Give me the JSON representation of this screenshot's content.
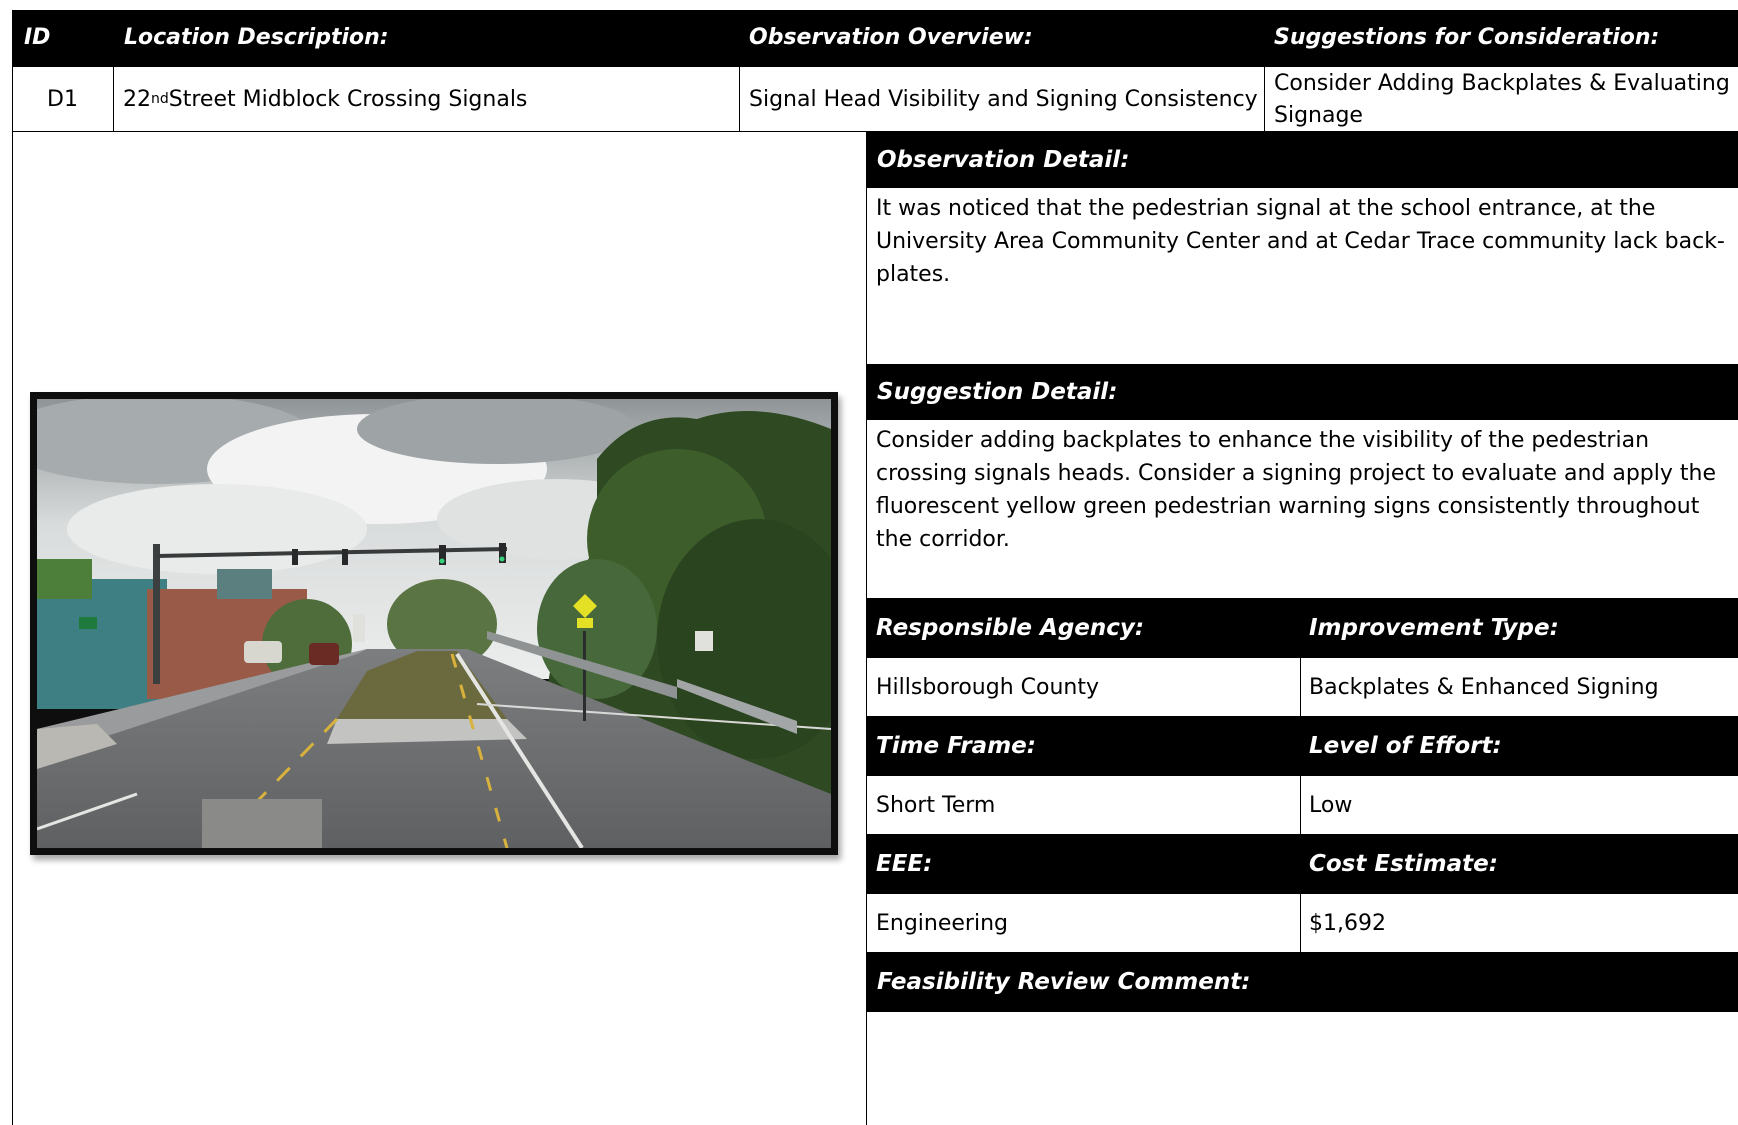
{
  "header": {
    "id": "ID",
    "location": "Location Description:",
    "observation": "Observation Overview:",
    "suggestions": "Suggestions for Consideration:"
  },
  "record": {
    "id": "D1",
    "location_number": "22",
    "location_sup": "nd",
    "location_rest": " Street Midblock Crossing Signals",
    "observation": "Signal Head Visibility and Signing Consistency",
    "suggestion": "Consider Adding Backplates & Evaluating Signage"
  },
  "observation_detail": {
    "label": "Observation Detail:",
    "text": "It was noticed that the pedestrian signal at the school entrance, at the University Area Community Center and at Cedar Trace community lack back-plates."
  },
  "suggestion_detail": {
    "label": "Suggestion Detail:",
    "text": "Consider adding backplates to enhance the visibility of the pedestrian crossing signals heads. Consider a signing project to evaluate and apply the fluorescent yellow green pedestrian warning signs consistently throughout the corridor."
  },
  "fields": {
    "responsible_agency_label": "Responsible Agency:",
    "responsible_agency": "Hillsborough County",
    "improvement_type_label": "Improvement Type:",
    "improvement_type": "Backplates & Enhanced Signing",
    "time_frame_label": "Time Frame:",
    "time_frame": "Short Term",
    "level_of_effort_label": "Level of Effort:",
    "level_of_effort": "Low",
    "eee_label": "EEE:",
    "eee": "Engineering",
    "cost_estimate_label": "Cost Estimate:",
    "cost_estimate": "$1,692",
    "feasibility_label": "Feasibility Review Comment:",
    "feasibility": ""
  },
  "photo": {
    "subject": "street-view-22nd-street-midblock-crossing"
  }
}
